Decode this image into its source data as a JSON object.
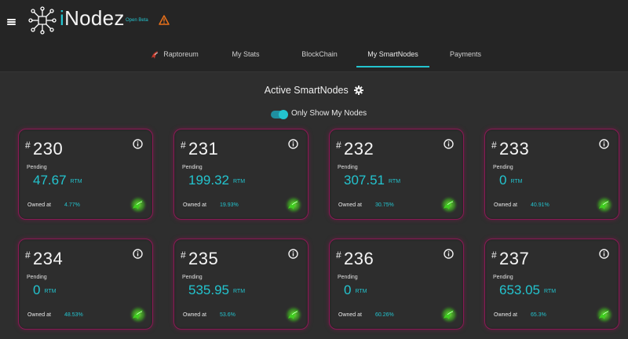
{
  "brand": {
    "name_first": "i",
    "name_rest": "Nodez",
    "beta_label": "Open Beta"
  },
  "nav": {
    "tabs": [
      {
        "label": "Raptoreum",
        "icon": "raptoreum-icon"
      },
      {
        "label": "My Stats"
      },
      {
        "label": "BlockChain"
      },
      {
        "label": "My SmartNodes",
        "active": true
      },
      {
        "label": "Payments"
      }
    ]
  },
  "section": {
    "title": "Active SmartNodes"
  },
  "filter": {
    "label": "Only Show My Nodes",
    "enabled": true
  },
  "card_labels": {
    "pending": "Pending",
    "owned_at": "Owned at",
    "unit": "RTM",
    "hash": "#"
  },
  "nodes": [
    {
      "id": "230",
      "pending": "47.67",
      "owned": "4.77%"
    },
    {
      "id": "231",
      "pending": "199.32",
      "owned": "19.93%"
    },
    {
      "id": "232",
      "pending": "307.51",
      "owned": "30.75%"
    },
    {
      "id": "233",
      "pending": "0",
      "owned": "40.91%"
    },
    {
      "id": "234",
      "pending": "0",
      "owned": "48.53%"
    },
    {
      "id": "235",
      "pending": "535.95",
      "owned": "53.6%"
    },
    {
      "id": "236",
      "pending": "0",
      "owned": "60.26%"
    },
    {
      "id": "237",
      "pending": "653.05",
      "owned": "65.3%"
    }
  ],
  "colors": {
    "accent": "#23c4cf",
    "card_border": "#8a1a55",
    "warning": "#e8701a",
    "badge_green": "#4fd02a"
  }
}
